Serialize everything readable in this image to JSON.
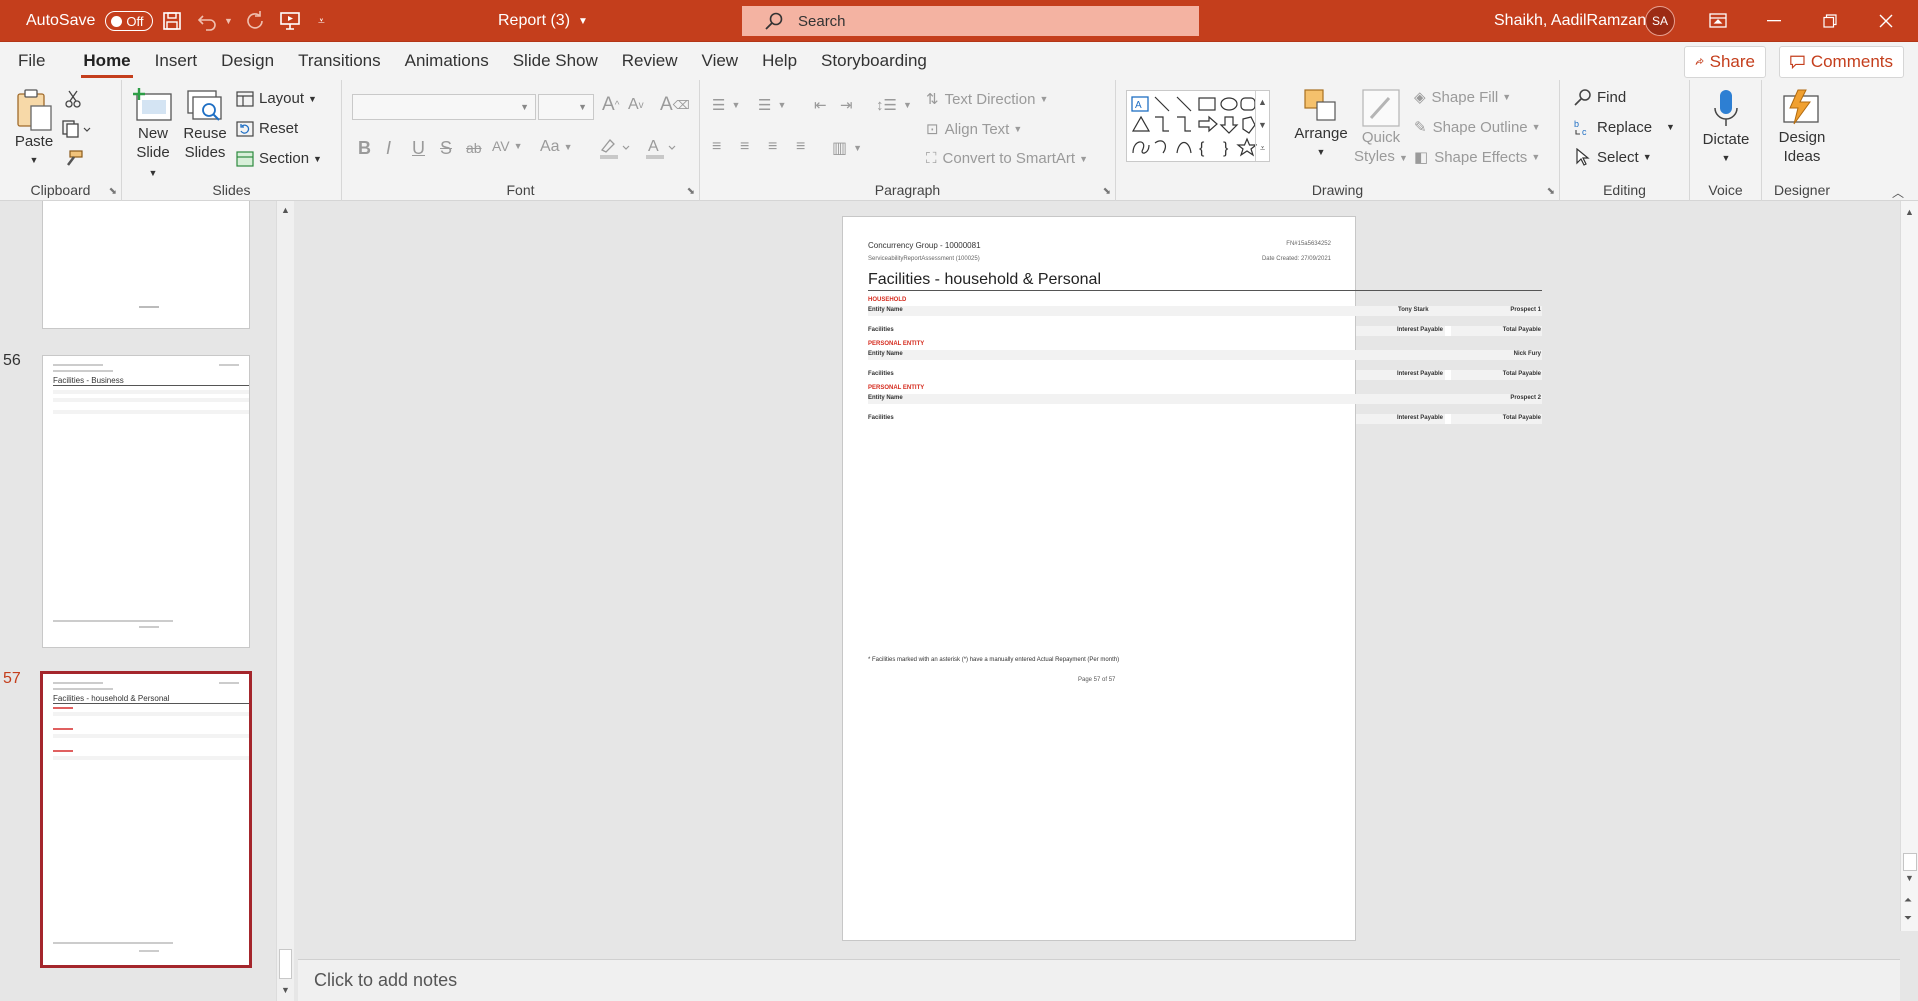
{
  "app": {
    "autosave_label": "AutoSave",
    "autosave_state": "Off",
    "doc_title": "Report (3)",
    "search_placeholder": "Search",
    "user_name": "Shaikh, AadilRamzan",
    "user_initials": "SA"
  },
  "tabs": [
    "File",
    "Home",
    "Insert",
    "Design",
    "Transitions",
    "Animations",
    "Slide Show",
    "Review",
    "View",
    "Help",
    "Storyboarding"
  ],
  "active_tab": "Home",
  "share_label": "Share",
  "comments_label": "Comments",
  "ribbon": {
    "clipboard": {
      "label": "Clipboard",
      "paste": "Paste"
    },
    "slides": {
      "label": "Slides",
      "new_slide_1": "New",
      "new_slide_2": "Slide",
      "reuse_1": "Reuse",
      "reuse_2": "Slides",
      "layout": "Layout",
      "reset": "Reset",
      "section": "Section"
    },
    "font": {
      "label": "Font"
    },
    "paragraph": {
      "label": "Paragraph",
      "text_direction": "Text Direction",
      "align_text": "Align Text",
      "convert_smartart": "Convert to SmartArt"
    },
    "drawing": {
      "label": "Drawing",
      "arrange": "Arrange",
      "quick_1": "Quick",
      "quick_2": "Styles",
      "shape_fill": "Shape Fill",
      "shape_outline": "Shape Outline",
      "shape_effects": "Shape Effects"
    },
    "editing": {
      "label": "Editing",
      "find": "Find",
      "replace": "Replace",
      "select": "Select"
    },
    "voice": {
      "label": "Voice",
      "dictate": "Dictate"
    },
    "designer": {
      "label": "Designer",
      "ideas_1": "Design",
      "ideas_2": "Ideas"
    }
  },
  "thumbnails": {
    "n56": "56",
    "n57": "57",
    "title56": "Facilities - Business",
    "title57": "Facilities - household & Personal"
  },
  "slide": {
    "group": "Concurrency Group - 10000081",
    "ref_id": "FN#15a5634252",
    "subtitle": "ServiceabilityReportAssessment (100025)",
    "date_created": "Date Created: 27/09/2021",
    "title": "Facilities - household & Personal",
    "sections": [
      {
        "header": "HOUSEHOLD",
        "entity_label": "Entity Name",
        "col1": "Tony Stark",
        "col2": "Prospect 1",
        "facilities": "Facilities",
        "interest": "Interest Payable",
        "total": "Total Payable"
      },
      {
        "header": "PERSONAL ENTITY",
        "entity_label": "Entity Name",
        "col1": "",
        "col2": "Nick Fury",
        "facilities": "Facilities",
        "interest": "Interest Payable",
        "total": "Total Payable"
      },
      {
        "header": "PERSONAL ENTITY",
        "entity_label": "Entity Name",
        "col1": "",
        "col2": "Prospect 2",
        "facilities": "Facilities",
        "interest": "Interest Payable",
        "total": "Total Payable"
      }
    ],
    "footnote": "* Facilities marked with an asterisk (*) have a manually entered Actual Repayment (Per month)",
    "page": "Page 57 of 57"
  },
  "notes_placeholder": "Click to add notes",
  "colors": {
    "accent": "#c43e1c",
    "red_text": "#d52b1e"
  }
}
